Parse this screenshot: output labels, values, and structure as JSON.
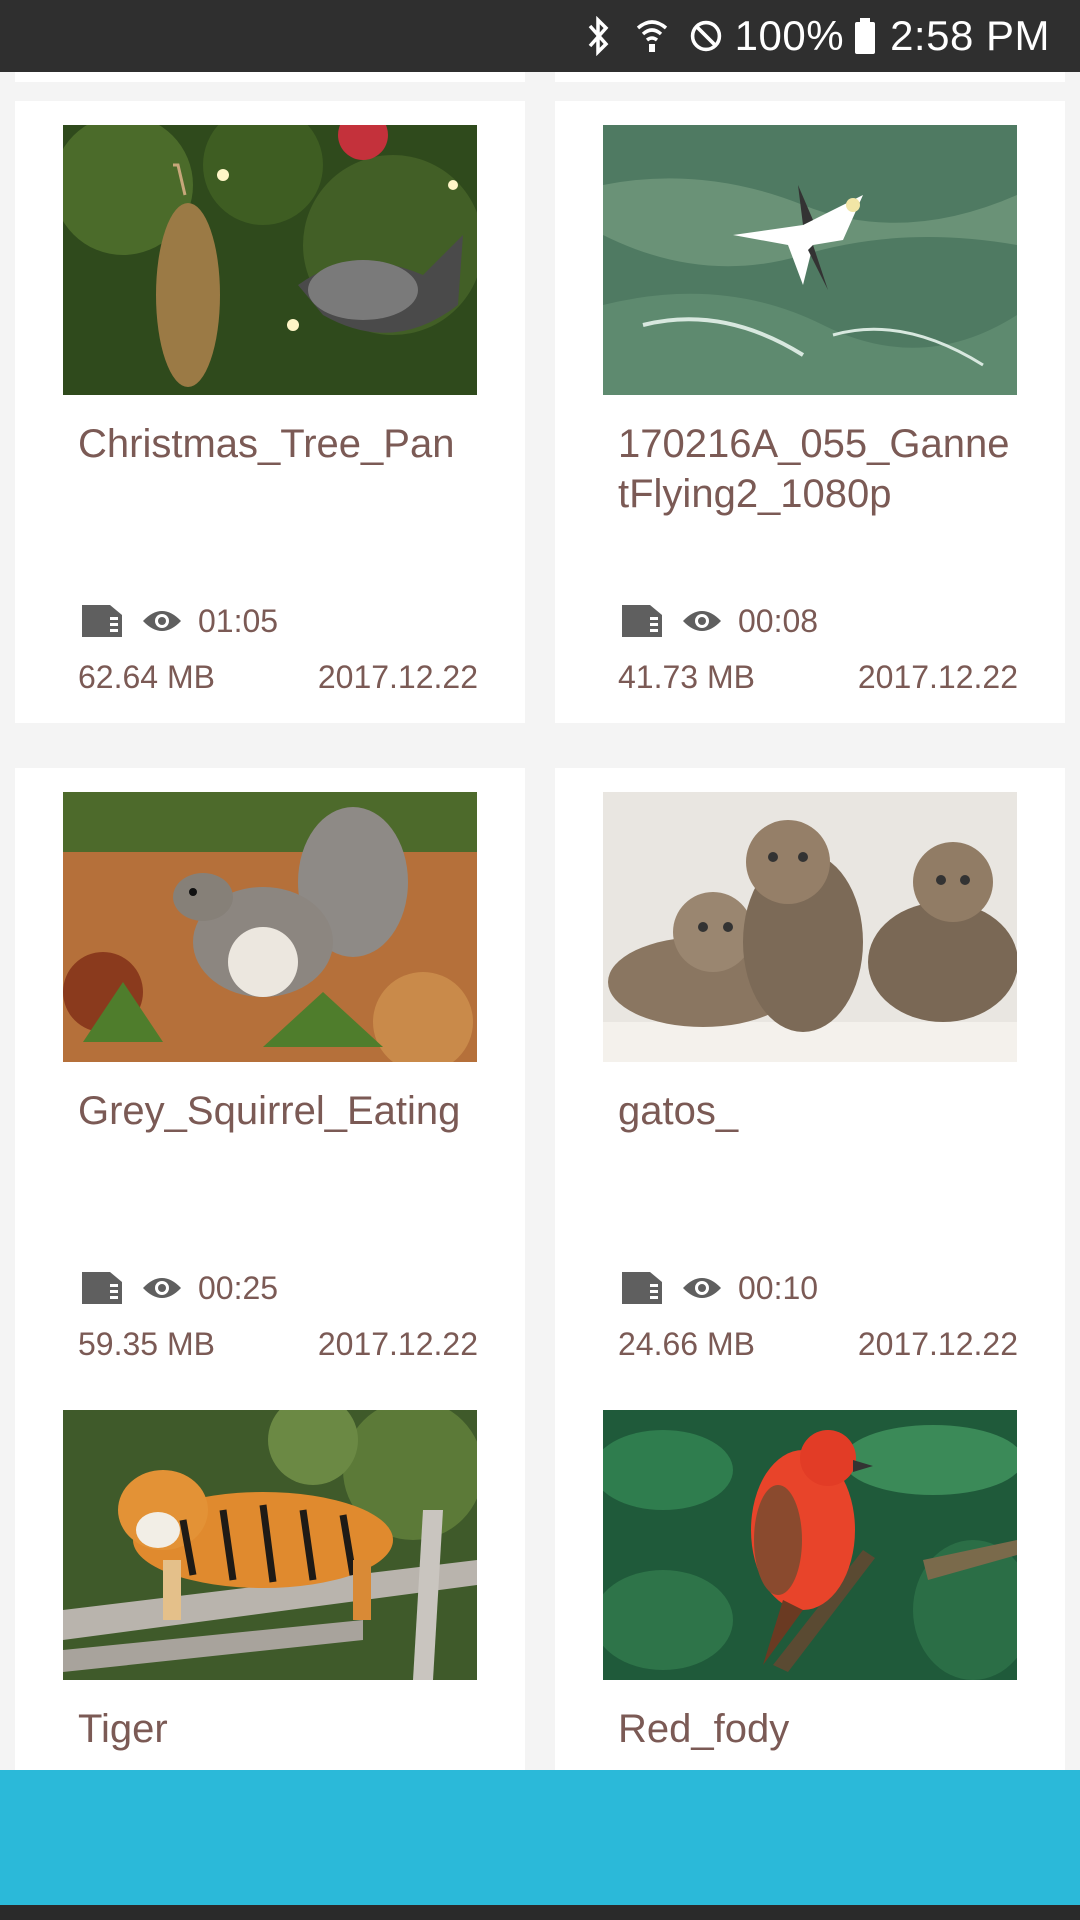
{
  "status_bar": {
    "battery": "100%",
    "time": "2:58 PM",
    "icons": [
      "bluetooth-icon",
      "wifi-icon",
      "do-not-disturb-icon",
      "battery-icon"
    ]
  },
  "videos": [
    {
      "title": "Christmas_Tree_Pan",
      "duration": "01:05",
      "size": "62.64 MB",
      "date": "2017.12.22",
      "thumbnail": "christmas-tree-ornaments"
    },
    {
      "title": "170216A_055_GannetFlying2_1080p",
      "duration": "00:08",
      "size": "41.73 MB",
      "date": "2017.12.22",
      "thumbnail": "gannet-over-sea"
    },
    {
      "title": "Grey_Squirrel_Eating",
      "duration": "00:25",
      "size": "59.35 MB",
      "date": "2017.12.22",
      "thumbnail": "grey-squirrel"
    },
    {
      "title": "gatos_",
      "duration": "00:10",
      "size": "24.66 MB",
      "date": "2017.12.22",
      "thumbnail": "kittens"
    },
    {
      "title": "Tiger",
      "thumbnail": "tiger-on-branch"
    },
    {
      "title": "Red_fody",
      "thumbnail": "red-fody-bird"
    }
  ],
  "colors": {
    "status_bar": "#2f2f2f",
    "text": "#7b5a55",
    "bottom_bar": "#2bb9d9",
    "background": "#f4f4f4"
  }
}
